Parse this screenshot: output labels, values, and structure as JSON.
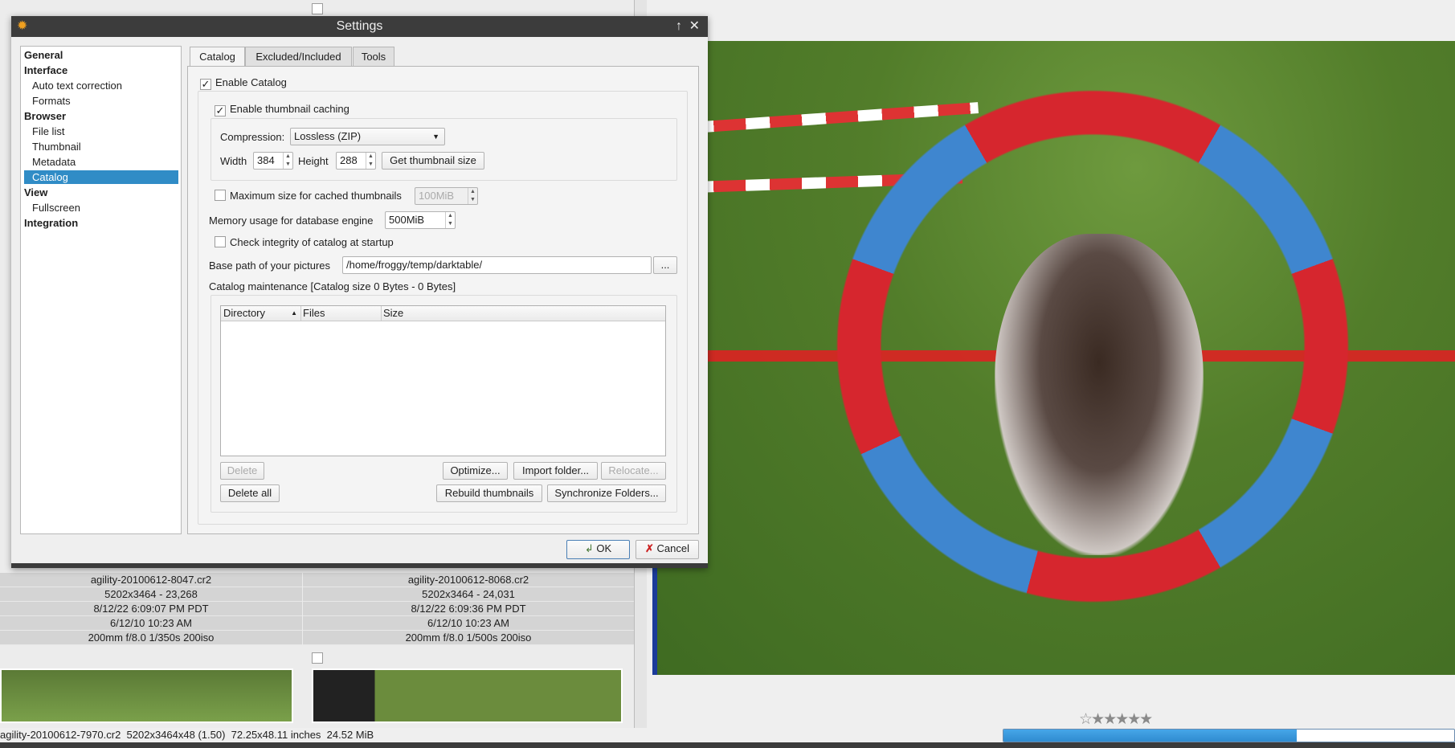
{
  "dialog": {
    "title": "Settings",
    "buttons": {
      "ok": "OK",
      "cancel": "Cancel"
    }
  },
  "sidebar": {
    "items": [
      {
        "label": "General",
        "type": "header"
      },
      {
        "label": "Interface",
        "type": "header"
      },
      {
        "label": "Auto text correction",
        "type": "child"
      },
      {
        "label": "Formats",
        "type": "child"
      },
      {
        "label": "Browser",
        "type": "header"
      },
      {
        "label": "File list",
        "type": "child"
      },
      {
        "label": "Thumbnail",
        "type": "child"
      },
      {
        "label": "Metadata",
        "type": "child"
      },
      {
        "label": "Catalog",
        "type": "child",
        "selected": true
      },
      {
        "label": "View",
        "type": "header"
      },
      {
        "label": "Fullscreen",
        "type": "child"
      },
      {
        "label": "Integration",
        "type": "header"
      }
    ]
  },
  "tabs": [
    {
      "label": "Catalog",
      "active": true
    },
    {
      "label": "Excluded/Included"
    },
    {
      "label": "Tools"
    }
  ],
  "catalog": {
    "enable_catalog": {
      "label": "Enable Catalog",
      "checked": true
    },
    "enable_thumb_cache": {
      "label": "Enable thumbnail caching",
      "checked": true
    },
    "compression_label": "Compression:",
    "compression_value": "Lossless (ZIP)",
    "width_label": "Width",
    "width_value": "384",
    "height_label": "Height",
    "height_value": "288",
    "get_thumb_size": "Get thumbnail size",
    "max_size": {
      "label": "Maximum size for cached thumbnails",
      "checked": false,
      "value": "100MiB"
    },
    "memory_label": "Memory usage for database engine",
    "memory_value": "500MiB",
    "check_integrity": {
      "label": "Check integrity of catalog at startup",
      "checked": false
    },
    "base_path_label": "Base path of your pictures",
    "base_path_value": "/home/froggy/temp/darktable/",
    "browse": "...",
    "maintenance_label": "Catalog maintenance [Catalog size 0 Bytes - 0 Bytes]",
    "columns": [
      "Directory",
      "Files",
      "Size"
    ],
    "buttons": {
      "delete": "Delete",
      "optimize": "Optimize...",
      "import": "Import folder...",
      "relocate": "Relocate...",
      "delete_all": "Delete all",
      "rebuild": "Rebuild thumbnails",
      "sync": "Synchronize Folders..."
    }
  },
  "files": [
    {
      "name": "agility-20100612-8047.cr2",
      "dims": "5202x3464 - 23,268",
      "added": "8/12/22 6:09:07 PM PDT",
      "taken": "6/12/10 10:23 AM",
      "exif": "200mm f/8.0 1/350s 200iso"
    },
    {
      "name": "agility-20100612-8068.cr2",
      "dims": "5202x3464 - 24,031",
      "added": "8/12/22 6:09:36 PM PDT",
      "taken": "6/12/10 10:23 AM",
      "exif": "200mm f/8.0 1/500s 200iso"
    }
  ],
  "status": {
    "text": "agility-20100612-7970.cr2  5202x3464x48 (1.50)  72.25x48.11 inches  24.52 MiB",
    "progress": 65,
    "progress_label": "65%",
    "rating": 0,
    "stars": "☆★★★★★"
  },
  "colors": {
    "accent": "#308cc6",
    "progress": "#3a9ae0"
  }
}
